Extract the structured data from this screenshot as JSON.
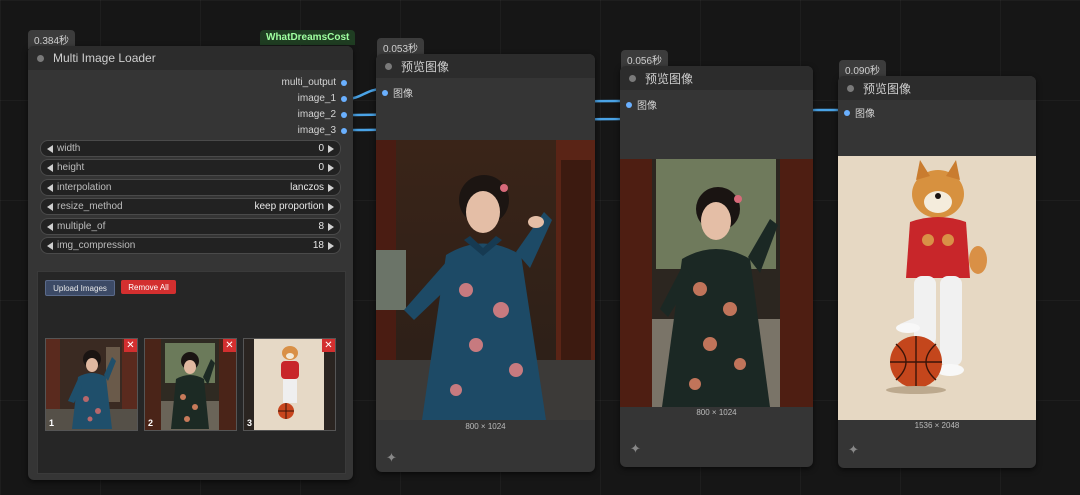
{
  "loader": {
    "time_badge": "0.384秒",
    "source_badge": "WhatDreamsCost",
    "title": "Multi Image Loader",
    "outputs": [
      "multi_output",
      "image_1",
      "image_2",
      "image_3"
    ],
    "widgets": [
      {
        "label": "width",
        "value": "0"
      },
      {
        "label": "height",
        "value": "0"
      },
      {
        "label": "interpolation",
        "value": "lanczos"
      },
      {
        "label": "resize_method",
        "value": "keep proportion"
      },
      {
        "label": "multiple_of",
        "value": "8"
      },
      {
        "label": "img_compression",
        "value": "18"
      }
    ],
    "upload_label": "Upload Images",
    "remove_label": "Remove All",
    "thumbs": [
      {
        "n": "1"
      },
      {
        "n": "2"
      },
      {
        "n": "3"
      }
    ],
    "remove_glyph": "✕"
  },
  "previews": [
    {
      "time_badge": "0.053秒",
      "title": "预览图像",
      "input_label": "图像",
      "dims": "800 × 1024"
    },
    {
      "time_badge": "0.056秒",
      "title": "预览图像",
      "input_label": "图像",
      "dims": "800 × 1024"
    },
    {
      "time_badge": "0.090秒",
      "title": "预览图像",
      "input_label": "图像",
      "dims": "1536 × 2048"
    }
  ],
  "colors": {
    "port": "#6ab0ff",
    "wire": "#4aa3e6",
    "remove_button": "#d32f2f",
    "upload_button": "#3c4a66",
    "source_badge": "#9fffa0"
  }
}
